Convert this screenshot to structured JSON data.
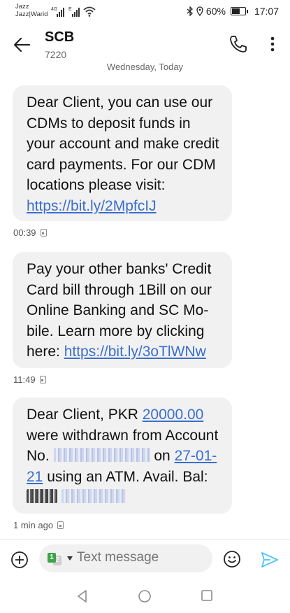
{
  "status_bar": {
    "carrier1": "Jazz",
    "carrier2": "Jazz|Warid",
    "net1": "4G",
    "net2": "E",
    "battery_percent": "60%",
    "time": "17:07",
    "icons": [
      "signal-icon",
      "wifi-icon",
      "bluetooth-icon",
      "location-icon",
      "battery-icon"
    ]
  },
  "header": {
    "contact_name": "SCB",
    "contact_number": "7220",
    "icons": [
      "back-arrow-icon",
      "phone-icon",
      "more-vertical-icon"
    ]
  },
  "date_separator": "Wednesday, Today",
  "messages": [
    {
      "text": "Dear Client, you can use our CDMs to deposit funds in your account and make credit card payments. For our CDM locations please visit: ",
      "link": "https://bit.ly/2MpfcIJ",
      "time": "00:39"
    },
    {
      "text": "Pay your other banks' Credit Card bill through 1Bill on our Online Banking and SC Mo-bile. Learn more by clicking here: ",
      "link": "https://bit.ly/3oTlWNw",
      "time": "11:49"
    },
    {
      "part1": "Dear Client, PKR ",
      "amount": "20000.00",
      "part2": " were withdrawn from Account No. ",
      "part3": "on ",
      "date": "27-01-21",
      "part4": " using an ATM. Avail. Bal: ",
      "time": "1 min ago"
    }
  ],
  "composer": {
    "placeholder": "Text message",
    "sim_primary": "1",
    "sim_secondary": "2",
    "icons": [
      "add-icon",
      "emoji-icon",
      "send-icon"
    ]
  },
  "colors": {
    "link": "#3a6ecf",
    "bubble": "#f1f1f1",
    "send": "#4fc3f7",
    "sim": "#3ca34a"
  }
}
